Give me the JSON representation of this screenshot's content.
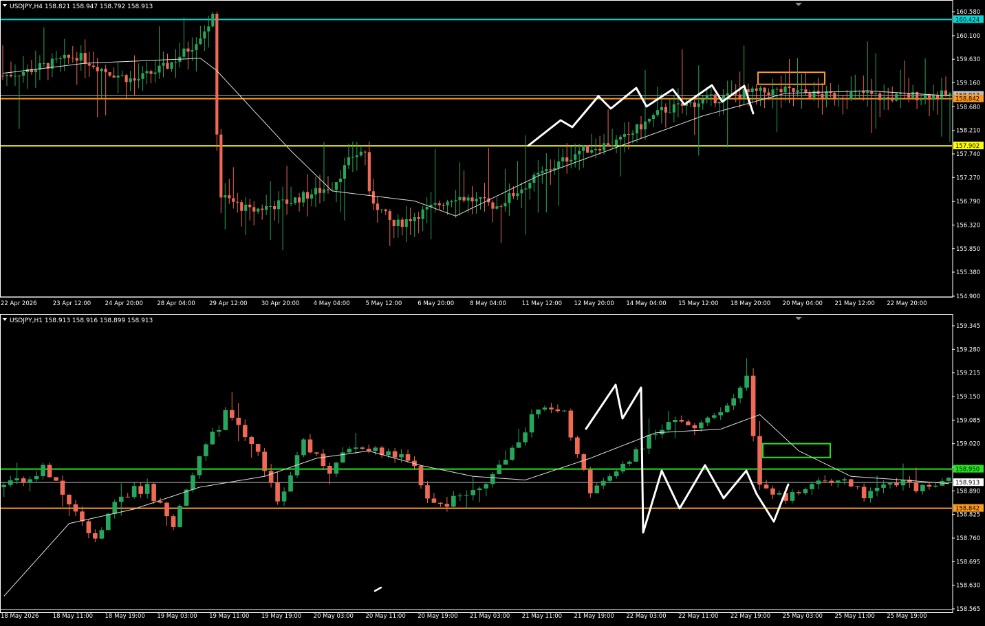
{
  "colors": {
    "background": "#000000",
    "axis": "#ffffff",
    "bull": "#26a65b",
    "bear": "#ef6a55",
    "ma": "#dddddd",
    "drawing": "#ffffff",
    "cyan": "#00d8d8",
    "yellow": "#ffff00",
    "orange": "#ff9a1e",
    "green": "#22e51e",
    "gray_line": "#b8b8b8"
  },
  "chart_data": [
    {
      "type": "candlestick",
      "symbol": "USDJPY",
      "timeframe": "H4",
      "title": "USDJPY,H4",
      "ohlc_header": "158.821 158.947 158.792 158.913",
      "y_ticks": [
        "160.580",
        "160.100",
        "159.630",
        "159.160",
        "158.680",
        "158.210",
        "157.740",
        "157.270",
        "156.790",
        "156.320",
        "155.850",
        "155.380",
        "154.900"
      ],
      "ylim": [
        154.9,
        160.58
      ],
      "x_labels": [
        "22 Apr 2026",
        "23 Apr 12:00",
        "24 Apr 20:00",
        "28 Apr 04:00",
        "29 Apr 12:00",
        "30 Apr 20:00",
        "4 May 04:00",
        "5 May 12:00",
        "6 May 20:00",
        "8 May 04:00",
        "11 May 12:00",
        "12 May 20:00",
        "14 May 04:00",
        "15 May 12:00",
        "18 May 20:00",
        "20 May 04:00",
        "21 May 12:00",
        "22 May 20:00"
      ],
      "horizontal_levels": [
        {
          "price": 160.424,
          "label": "160.424",
          "color": "#00d8d8"
        },
        {
          "price": 158.913,
          "label": "",
          "color": "#b8b8b8"
        },
        {
          "price": 158.842,
          "label": "158.842",
          "color": "#ff9a1e"
        },
        {
          "price": 157.902,
          "label": "157.902",
          "color": "#ffff00"
        }
      ],
      "price_badges": [
        {
          "price": 160.424,
          "label": "160.424",
          "bg": "#00d8d8",
          "fg": "#000000"
        },
        {
          "price": 158.913,
          "label": "158.913",
          "bg": "#c0c0c0",
          "fg": "#000000"
        },
        {
          "price": 158.842,
          "label": "158.842",
          "bg": "#ff9a1e",
          "fg": "#000000"
        },
        {
          "price": 157.902,
          "label": "157.902",
          "bg": "#ffff00",
          "fg": "#000000"
        }
      ],
      "target_box": {
        "price_low": 159.13,
        "price_high": 159.37,
        "color": "#ff9a1e"
      },
      "anchor_closes": [
        [
          0,
          159.3
        ],
        [
          6,
          159.4
        ],
        [
          12,
          159.55
        ],
        [
          18,
          159.7
        ],
        [
          25,
          159.4
        ],
        [
          32,
          159.2
        ],
        [
          40,
          159.5
        ],
        [
          46,
          159.9
        ],
        [
          51,
          160.45
        ],
        [
          52,
          158.2
        ],
        [
          53,
          156.9
        ],
        [
          60,
          156.6
        ],
        [
          70,
          156.8
        ],
        [
          80,
          157.1
        ],
        [
          85,
          157.7
        ],
        [
          88,
          157.8
        ],
        [
          89,
          156.9
        ],
        [
          95,
          156.3
        ],
        [
          100,
          156.5
        ],
        [
          110,
          156.9
        ],
        [
          120,
          156.7
        ],
        [
          130,
          157.3
        ],
        [
          140,
          157.8
        ],
        [
          150,
          158.0
        ],
        [
          160,
          158.6
        ],
        [
          170,
          158.8
        ],
        [
          180,
          158.95
        ],
        [
          190,
          159.0
        ],
        [
          200,
          158.9
        ],
        [
          209,
          158.95
        ],
        [
          214,
          158.85
        ],
        [
          220,
          158.9
        ],
        [
          230,
          158.913
        ]
      ],
      "ma_anchor": [
        [
          0,
          159.35
        ],
        [
          20,
          159.55
        ],
        [
          48,
          159.65
        ],
        [
          52,
          159.4
        ],
        [
          70,
          157.8
        ],
        [
          80,
          157.0
        ],
        [
          100,
          156.8
        ],
        [
          110,
          156.5
        ],
        [
          130,
          157.3
        ],
        [
          150,
          157.9
        ],
        [
          170,
          158.5
        ],
        [
          190,
          158.95
        ],
        [
          210,
          159.0
        ],
        [
          230,
          158.9
        ]
      ]
    },
    {
      "type": "candlestick",
      "symbol": "USDJPY",
      "timeframe": "H1",
      "title": "USDJPY,H1",
      "ohlc_header": "158.913 158.916 158.899 158.913",
      "y_ticks": [
        "159.345",
        "159.280",
        "159.215",
        "159.150",
        "159.085",
        "159.020",
        "158.955",
        "158.890",
        "158.825",
        "158.760",
        "158.695",
        "158.630",
        "158.565"
      ],
      "ylim": [
        158.565,
        159.345
      ],
      "x_labels": [
        "18 May 2026",
        "18 May 11:00",
        "18 May 19:00",
        "19 May 03:00",
        "19 May 11:00",
        "19 May 19:00",
        "20 May 03:00",
        "20 May 11:00",
        "20 May 19:00",
        "21 May 03:00",
        "21 May 11:00",
        "21 May 19:00",
        "22 May 03:00",
        "22 May 11:00",
        "22 May 19:00",
        "25 May 03:00",
        "25 May 11:00",
        "25 May 19:00"
      ],
      "horizontal_levels": [
        {
          "price": 158.95,
          "label": "158.950",
          "color": "#22e51e"
        },
        {
          "price": 158.913,
          "label": "",
          "color": "#b8b8b8"
        },
        {
          "price": 158.842,
          "label": "158.842",
          "color": "#ff9a1e"
        }
      ],
      "price_badges": [
        {
          "price": 158.95,
          "label": "158.950",
          "bg": "#22e51e",
          "fg": "#000000"
        },
        {
          "price": 158.913,
          "label": "158.913",
          "bg": "#ffffff",
          "fg": "#000000"
        },
        {
          "price": 158.842,
          "label": "158.842",
          "bg": "#ff9a1e",
          "fg": "#000000"
        }
      ],
      "target_box": {
        "price_low": 158.982,
        "price_high": 159.02,
        "color": "#22e51e"
      },
      "anchor_closes": [
        [
          0,
          158.9
        ],
        [
          6,
          158.95
        ],
        [
          10,
          158.86
        ],
        [
          14,
          158.75
        ],
        [
          18,
          158.88
        ],
        [
          22,
          158.9
        ],
        [
          26,
          158.8
        ],
        [
          30,
          158.98
        ],
        [
          34,
          159.1
        ],
        [
          38,
          159.03
        ],
        [
          42,
          158.86
        ],
        [
          46,
          159.02
        ],
        [
          50,
          158.95
        ],
        [
          54,
          159.02
        ],
        [
          58,
          159.0
        ],
        [
          62,
          158.98
        ],
        [
          66,
          158.85
        ],
        [
          70,
          158.87
        ],
        [
          74,
          158.92
        ],
        [
          78,
          159.0
        ],
        [
          82,
          159.12
        ],
        [
          86,
          159.1
        ],
        [
          90,
          158.88
        ],
        [
          94,
          158.93
        ],
        [
          98,
          159.02
        ],
        [
          102,
          159.08
        ],
        [
          106,
          159.07
        ],
        [
          110,
          159.1
        ],
        [
          114,
          159.2
        ],
        [
          116,
          158.9
        ],
        [
          120,
          158.87
        ],
        [
          124,
          158.9
        ],
        [
          128,
          158.92
        ],
        [
          132,
          158.88
        ],
        [
          136,
          158.92
        ],
        [
          140,
          158.9
        ],
        [
          145,
          158.913
        ]
      ],
      "ma_anchor": [
        [
          0,
          158.6
        ],
        [
          10,
          158.8
        ],
        [
          20,
          158.84
        ],
        [
          30,
          158.9
        ],
        [
          40,
          158.93
        ],
        [
          48,
          158.98
        ],
        [
          56,
          159.0
        ],
        [
          64,
          158.96
        ],
        [
          72,
          158.93
        ],
        [
          80,
          158.92
        ],
        [
          90,
          158.98
        ],
        [
          100,
          159.05
        ],
        [
          110,
          159.06
        ],
        [
          116,
          159.1
        ],
        [
          122,
          159.0
        ],
        [
          130,
          158.93
        ],
        [
          138,
          158.92
        ],
        [
          145,
          158.91
        ]
      ]
    }
  ],
  "drawings": [
    {
      "pane": 0,
      "kind": "zigzag",
      "note": "manual white zigzag path"
    },
    {
      "pane": 1,
      "kind": "zigzag",
      "note": "manual white zigzag path"
    }
  ]
}
